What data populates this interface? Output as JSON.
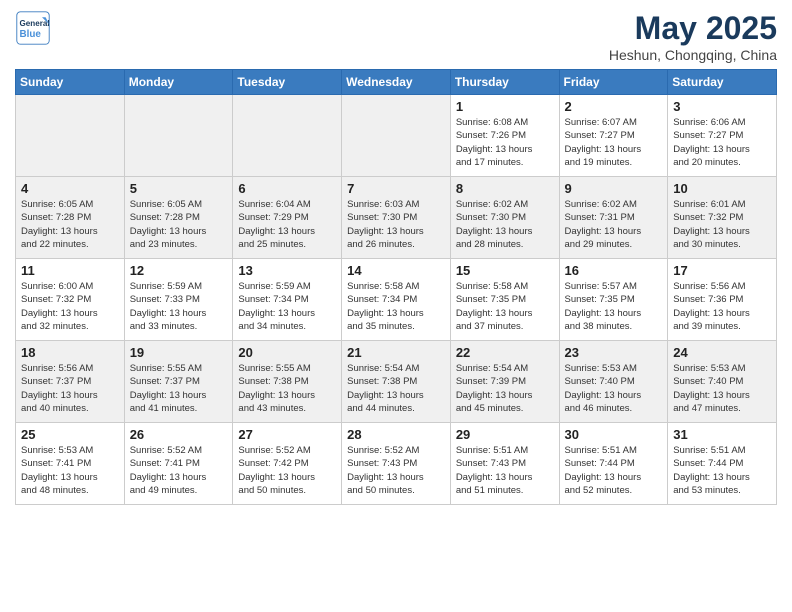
{
  "header": {
    "logo_line1": "General",
    "logo_line2": "Blue",
    "month": "May 2025",
    "location": "Heshun, Chongqing, China"
  },
  "weekdays": [
    "Sunday",
    "Monday",
    "Tuesday",
    "Wednesday",
    "Thursday",
    "Friday",
    "Saturday"
  ],
  "weeks": [
    [
      {
        "day": "",
        "info": ""
      },
      {
        "day": "",
        "info": ""
      },
      {
        "day": "",
        "info": ""
      },
      {
        "day": "",
        "info": ""
      },
      {
        "day": "1",
        "info": "Sunrise: 6:08 AM\nSunset: 7:26 PM\nDaylight: 13 hours\nand 17 minutes."
      },
      {
        "day": "2",
        "info": "Sunrise: 6:07 AM\nSunset: 7:27 PM\nDaylight: 13 hours\nand 19 minutes."
      },
      {
        "day": "3",
        "info": "Sunrise: 6:06 AM\nSunset: 7:27 PM\nDaylight: 13 hours\nand 20 minutes."
      }
    ],
    [
      {
        "day": "4",
        "info": "Sunrise: 6:05 AM\nSunset: 7:28 PM\nDaylight: 13 hours\nand 22 minutes."
      },
      {
        "day": "5",
        "info": "Sunrise: 6:05 AM\nSunset: 7:28 PM\nDaylight: 13 hours\nand 23 minutes."
      },
      {
        "day": "6",
        "info": "Sunrise: 6:04 AM\nSunset: 7:29 PM\nDaylight: 13 hours\nand 25 minutes."
      },
      {
        "day": "7",
        "info": "Sunrise: 6:03 AM\nSunset: 7:30 PM\nDaylight: 13 hours\nand 26 minutes."
      },
      {
        "day": "8",
        "info": "Sunrise: 6:02 AM\nSunset: 7:30 PM\nDaylight: 13 hours\nand 28 minutes."
      },
      {
        "day": "9",
        "info": "Sunrise: 6:02 AM\nSunset: 7:31 PM\nDaylight: 13 hours\nand 29 minutes."
      },
      {
        "day": "10",
        "info": "Sunrise: 6:01 AM\nSunset: 7:32 PM\nDaylight: 13 hours\nand 30 minutes."
      }
    ],
    [
      {
        "day": "11",
        "info": "Sunrise: 6:00 AM\nSunset: 7:32 PM\nDaylight: 13 hours\nand 32 minutes."
      },
      {
        "day": "12",
        "info": "Sunrise: 5:59 AM\nSunset: 7:33 PM\nDaylight: 13 hours\nand 33 minutes."
      },
      {
        "day": "13",
        "info": "Sunrise: 5:59 AM\nSunset: 7:34 PM\nDaylight: 13 hours\nand 34 minutes."
      },
      {
        "day": "14",
        "info": "Sunrise: 5:58 AM\nSunset: 7:34 PM\nDaylight: 13 hours\nand 35 minutes."
      },
      {
        "day": "15",
        "info": "Sunrise: 5:58 AM\nSunset: 7:35 PM\nDaylight: 13 hours\nand 37 minutes."
      },
      {
        "day": "16",
        "info": "Sunrise: 5:57 AM\nSunset: 7:35 PM\nDaylight: 13 hours\nand 38 minutes."
      },
      {
        "day": "17",
        "info": "Sunrise: 5:56 AM\nSunset: 7:36 PM\nDaylight: 13 hours\nand 39 minutes."
      }
    ],
    [
      {
        "day": "18",
        "info": "Sunrise: 5:56 AM\nSunset: 7:37 PM\nDaylight: 13 hours\nand 40 minutes."
      },
      {
        "day": "19",
        "info": "Sunrise: 5:55 AM\nSunset: 7:37 PM\nDaylight: 13 hours\nand 41 minutes."
      },
      {
        "day": "20",
        "info": "Sunrise: 5:55 AM\nSunset: 7:38 PM\nDaylight: 13 hours\nand 43 minutes."
      },
      {
        "day": "21",
        "info": "Sunrise: 5:54 AM\nSunset: 7:38 PM\nDaylight: 13 hours\nand 44 minutes."
      },
      {
        "day": "22",
        "info": "Sunrise: 5:54 AM\nSunset: 7:39 PM\nDaylight: 13 hours\nand 45 minutes."
      },
      {
        "day": "23",
        "info": "Sunrise: 5:53 AM\nSunset: 7:40 PM\nDaylight: 13 hours\nand 46 minutes."
      },
      {
        "day": "24",
        "info": "Sunrise: 5:53 AM\nSunset: 7:40 PM\nDaylight: 13 hours\nand 47 minutes."
      }
    ],
    [
      {
        "day": "25",
        "info": "Sunrise: 5:53 AM\nSunset: 7:41 PM\nDaylight: 13 hours\nand 48 minutes."
      },
      {
        "day": "26",
        "info": "Sunrise: 5:52 AM\nSunset: 7:41 PM\nDaylight: 13 hours\nand 49 minutes."
      },
      {
        "day": "27",
        "info": "Sunrise: 5:52 AM\nSunset: 7:42 PM\nDaylight: 13 hours\nand 50 minutes."
      },
      {
        "day": "28",
        "info": "Sunrise: 5:52 AM\nSunset: 7:43 PM\nDaylight: 13 hours\nand 50 minutes."
      },
      {
        "day": "29",
        "info": "Sunrise: 5:51 AM\nSunset: 7:43 PM\nDaylight: 13 hours\nand 51 minutes."
      },
      {
        "day": "30",
        "info": "Sunrise: 5:51 AM\nSunset: 7:44 PM\nDaylight: 13 hours\nand 52 minutes."
      },
      {
        "day": "31",
        "info": "Sunrise: 5:51 AM\nSunset: 7:44 PM\nDaylight: 13 hours\nand 53 minutes."
      }
    ]
  ]
}
